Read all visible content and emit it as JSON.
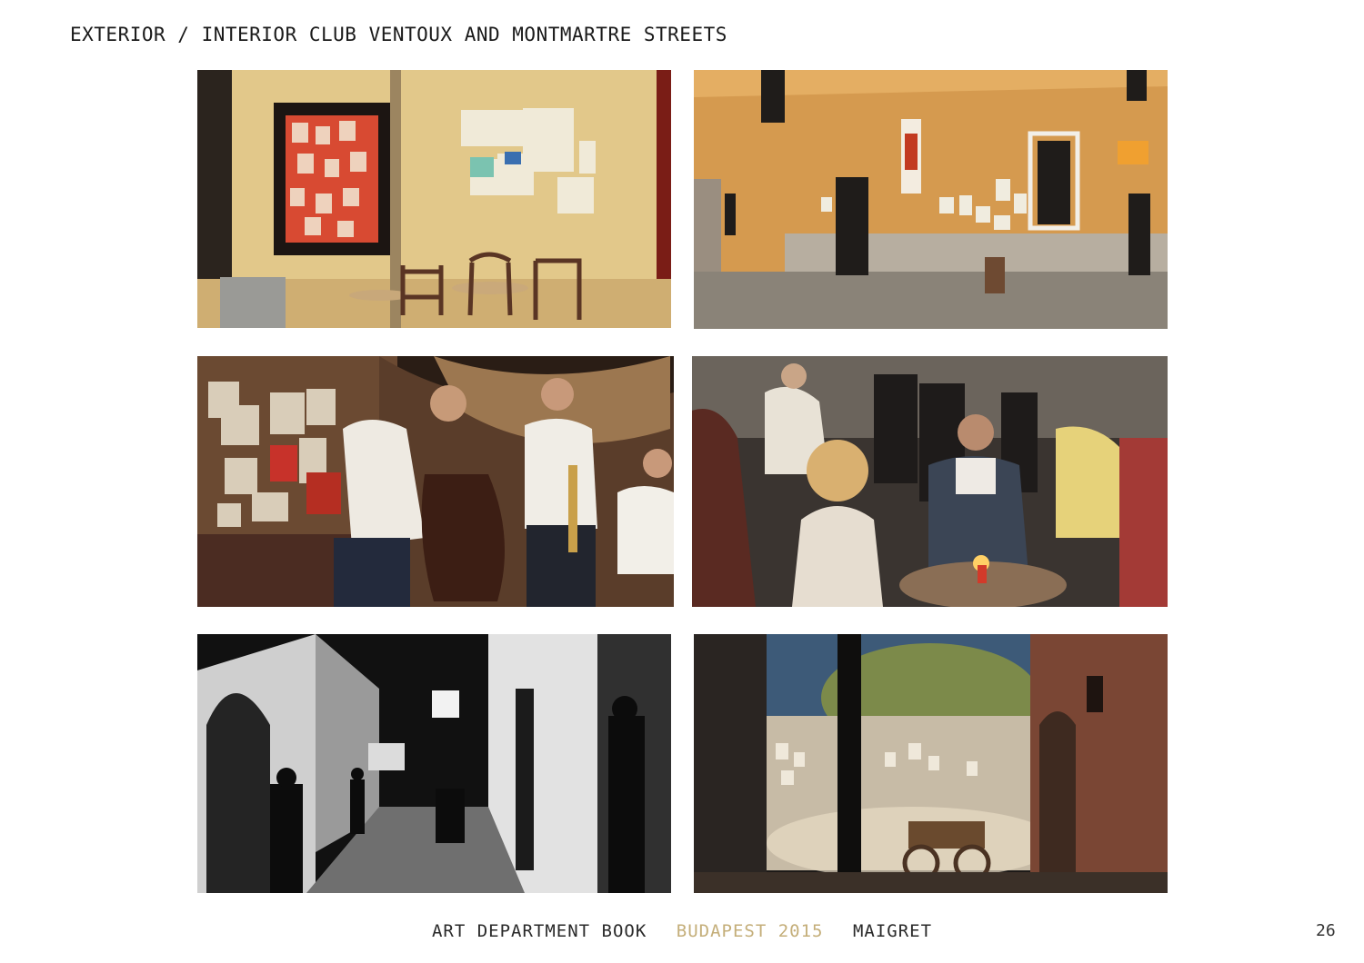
{
  "page": {
    "title": "EXTERIOR / INTERIOR CLUB VENTOUX AND MONTMARTRE STREETS",
    "page_number": "26"
  },
  "footer": {
    "book": "ART DEPARTMENT BOOK",
    "place_year": "BUDAPEST 2015",
    "film": "MAIGRET"
  },
  "photos": [
    {
      "id": "p1",
      "subject": "club-ventoux-facade-with-showcase-and-cafe-tables"
    },
    {
      "id": "p2",
      "subject": "street-corner-ochre-building-with-club-signs"
    },
    {
      "id": "p3",
      "subject": "interior-band-double-bass-trumpet"
    },
    {
      "id": "p4",
      "subject": "interior-crowded-club-table-with-candle"
    },
    {
      "id": "p5",
      "subject": "black-and-white-night-alley"
    },
    {
      "id": "p6",
      "subject": "night-courtyard-with-cart-and-tree"
    }
  ],
  "colors": {
    "footer_accent": "#c4ae79",
    "text": "#1a1a1a"
  }
}
